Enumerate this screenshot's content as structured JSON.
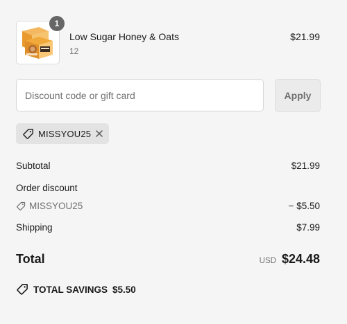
{
  "product": {
    "quantity": "1",
    "name": "Low Sugar Honey & Oats",
    "variant": "12",
    "price": "$21.99",
    "image_icon": "product-box-image"
  },
  "discount": {
    "placeholder": "Discount code or gift card",
    "value": "",
    "apply_label": "Apply"
  },
  "applied_code": {
    "label": "MISSYOU25",
    "tag_icon": "tag-icon",
    "remove_icon": "close-icon"
  },
  "summary": {
    "subtotal_label": "Subtotal",
    "subtotal_value": "$21.99",
    "order_discount_label": "Order discount",
    "code_label": "MISSYOU25",
    "code_value": "− $5.50",
    "shipping_label": "Shipping",
    "shipping_value": "$7.99",
    "total_label": "Total",
    "currency": "USD",
    "total_value": "$24.48",
    "savings_label": "TOTAL SAVINGS",
    "savings_value": "$5.50"
  },
  "colors": {
    "background": "#f5f5f5",
    "muted_text": "#707070",
    "badge": "#666666",
    "chip": "#e3e3e3"
  }
}
